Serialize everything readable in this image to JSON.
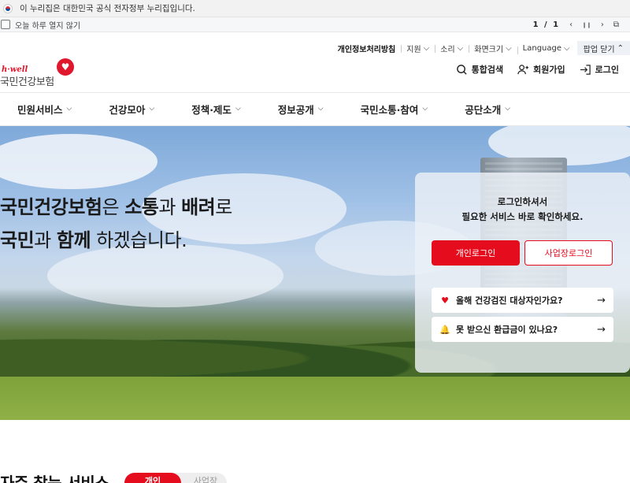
{
  "gov_banner": {
    "text": "이 누리집은 대한민국 공식 전자정부 누리집입니다."
  },
  "popup_bar": {
    "dont_show_today": "오늘 하루 열지 않기",
    "page": "1 / 1",
    "prev": "‹",
    "pause": "❙❙",
    "next": "›",
    "window": "⧉"
  },
  "util_nav": {
    "items": [
      {
        "label": "개인정보처리방침",
        "bold": true
      },
      {
        "label": "지원",
        "chevron": "⌵"
      },
      {
        "label": "소리",
        "chevron": "⌵"
      },
      {
        "label": "화면크기",
        "chevron": "⌵"
      },
      {
        "label": "Language",
        "chevron": "⌵"
      }
    ],
    "close_popup": "팝업 닫기",
    "close_chevron": "⌃"
  },
  "logo": {
    "tagline": "h·well",
    "name": "국민건강보험",
    "icon": "heart-icon"
  },
  "header": {
    "search": "통합검색",
    "signup": "회원가입",
    "login": "로그인"
  },
  "gnb": {
    "menus": [
      "민원서비스",
      "건강모아",
      "정책·제도",
      "정보공개",
      "국민소통·참여",
      "공단소개"
    ],
    "chevron": "⌵"
  },
  "hero": {
    "line1_a": "국민건강보험",
    "line1_b": "은 ",
    "line1_c": "소통",
    "line1_d": "과 ",
    "line1_e": "배려",
    "line1_f": "로",
    "line2_a": "국민",
    "line2_b": "과 ",
    "line2_c": "함께",
    "line2_d": " 하겠습니다."
  },
  "login_box": {
    "msg_line1": "로그인하셔서",
    "msg_line2": "필요한 서비스 바로 확인하세요.",
    "personal_login": "개인로그인",
    "business_login": "사업장로그인",
    "link1": "올해 건강검진 대상자인가요?",
    "link2": "못 받으신 환급금이 있나요?",
    "arrow": "→"
  },
  "frequent": {
    "title": "자주 찾는 서비스",
    "tab_personal": "개인",
    "tab_business": "사업장"
  },
  "colors": {
    "brand_red": "#e50c1e"
  }
}
